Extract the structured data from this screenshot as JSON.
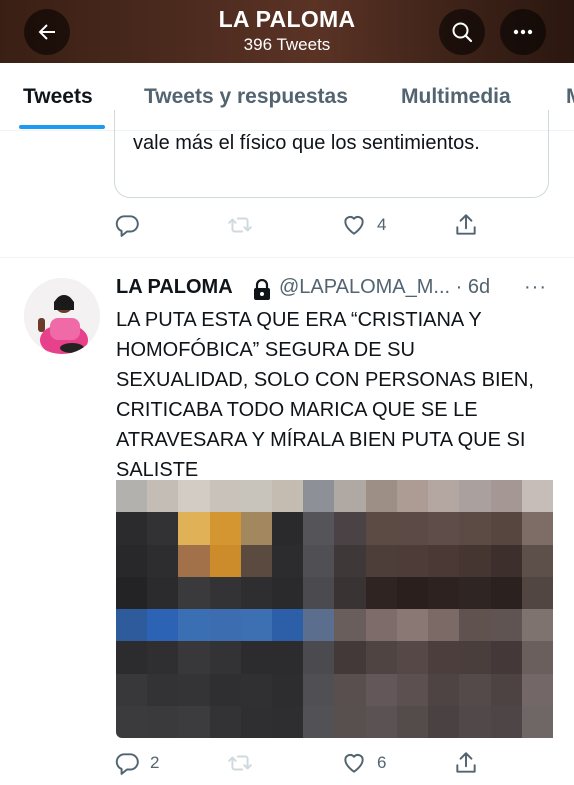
{
  "header": {
    "title": "LA PALOMA",
    "subtitle": "396 Tweets",
    "icons": [
      "back-arrow-icon",
      "search-icon",
      "more-icon"
    ]
  },
  "tabs": [
    {
      "label": "Tweets",
      "active": true
    },
    {
      "label": "Tweets y respuestas",
      "active": false
    },
    {
      "label": "Multimedia",
      "active": false
    },
    {
      "label": "M",
      "active": false
    }
  ],
  "quoted_tweet": {
    "text": "vale más el físico que los sentimientos.",
    "actions": {
      "reply": "",
      "retweet": "",
      "like": "4",
      "share": ""
    }
  },
  "tweet": {
    "name": "LA PALOMA",
    "protected": true,
    "handle": "@LAPALOMA_M...",
    "time": "· 6d",
    "more": "···",
    "text": "LA PUTA ESTA QUE ERA “CRISTIANA Y HOMOFÓBICA” SEGURA DE SU SEXUALIDAD, SOLO CON PERSONAS BIEN, CRITICABA TODO MARICA QUE SE LE ATRAVESARA Y MÍRALA BIEN PUTA QUE SI SALISTE",
    "media": "pixelated-image",
    "actions": {
      "reply": "2",
      "retweet": "",
      "like": "6",
      "share": ""
    }
  },
  "colors": {
    "accent": "#1d9bf0",
    "secondary_text": "#536471",
    "primary_text": "#0f1419"
  }
}
